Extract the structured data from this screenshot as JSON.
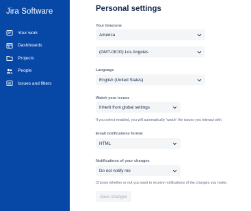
{
  "sidebar": {
    "brand": "Jira Software",
    "items": [
      {
        "label": "Your work",
        "icon": "your-work-icon"
      },
      {
        "label": "Dashboards",
        "icon": "dashboards-icon"
      },
      {
        "label": "Projects",
        "icon": "projects-icon"
      },
      {
        "label": "People",
        "icon": "people-icon"
      },
      {
        "label": "Issues and filters",
        "icon": "issues-filters-icon"
      }
    ]
  },
  "page": {
    "title": "Personal settings"
  },
  "settings": {
    "timezone": {
      "label": "Your timezone",
      "region": "America",
      "zone": "(GMT-08:00) Los Angeles"
    },
    "language": {
      "label": "Language",
      "value": "English (United States)"
    },
    "watch": {
      "label": "Watch your issues",
      "value": "Inherit from global settings",
      "help": "If you select enabled, you will automatically 'watch' the issues you interact with."
    },
    "email_format": {
      "label": "Email notifications format",
      "value": "HTML"
    },
    "notifications": {
      "label": "Notifications of your changes",
      "value": "Do not notify me",
      "help": "Choose whether or not you want to receive notifications of the changes you make."
    }
  },
  "actions": {
    "save_label": "Save changes"
  },
  "colors": {
    "sidebar_bg": "#0747a6",
    "field_bg": "#f4f5f7",
    "text": "#172b4d",
    "muted": "#5e6c84"
  }
}
